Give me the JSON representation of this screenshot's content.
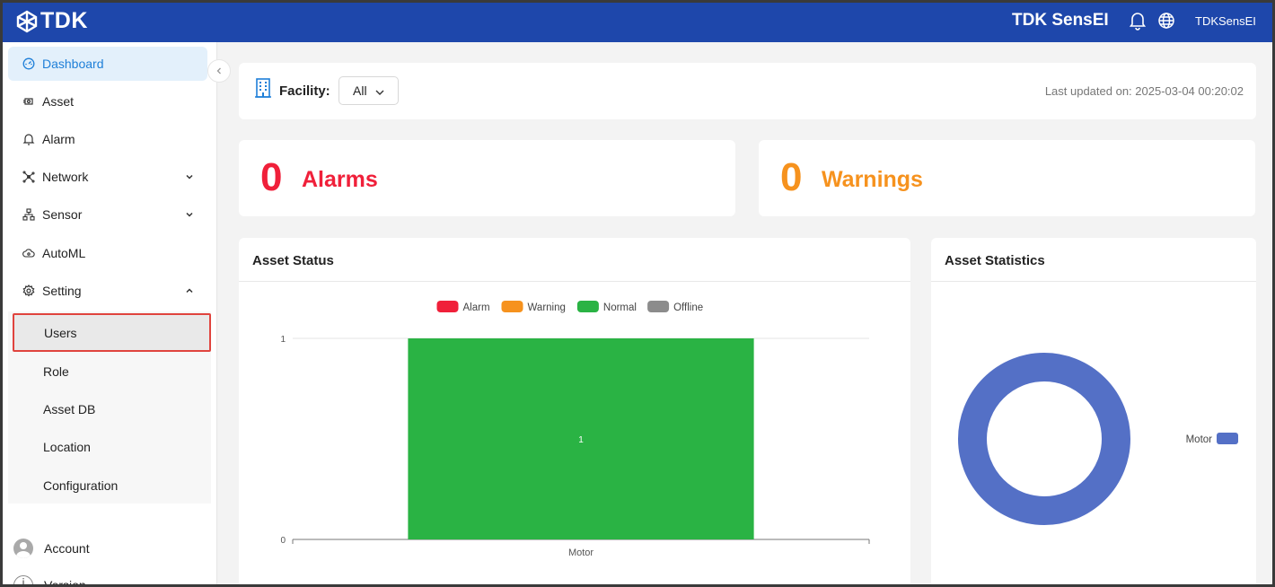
{
  "header": {
    "logo_text": "TDK",
    "product_name": "TDK SensEI",
    "username": "TDKSensEI",
    "brand_color": "#1e47ab"
  },
  "sidebar": {
    "items": [
      {
        "label": "Dashboard",
        "icon": "dashboard-icon",
        "active": true
      },
      {
        "label": "Asset",
        "icon": "asset-icon"
      },
      {
        "label": "Alarm",
        "icon": "bell-icon"
      },
      {
        "label": "Network",
        "icon": "network-icon",
        "expandable": true
      },
      {
        "label": "Sensor",
        "icon": "sensor-icon",
        "expandable": true
      },
      {
        "label": "AutoML",
        "icon": "automl-icon"
      },
      {
        "label": "Setting",
        "icon": "gear-icon",
        "expanded": true
      }
    ],
    "setting_subitems": [
      {
        "label": "Users",
        "selected": true
      },
      {
        "label": "Role"
      },
      {
        "label": "Asset DB"
      },
      {
        "label": "Location"
      },
      {
        "label": "Configuration"
      }
    ],
    "account_label": "Account",
    "version_label": "Version"
  },
  "filter": {
    "facility_label": "Facility:",
    "facility_value": "All",
    "last_updated": "Last updated on: 2025-03-04 00:20:02"
  },
  "summary": {
    "alarms_count": "0",
    "alarms_label": "Alarms",
    "warnings_count": "0",
    "warnings_label": "Warnings",
    "alarm_color": "#f0203a",
    "warning_color": "#f6921e"
  },
  "asset_status": {
    "title": "Asset Status"
  },
  "asset_statistics": {
    "title": "Asset Statistics"
  },
  "chart_data": [
    {
      "type": "bar",
      "categories": [
        "Motor"
      ],
      "series": [
        {
          "name": "Alarm",
          "values": [
            0
          ],
          "color": "#f0203a"
        },
        {
          "name": "Warning",
          "values": [
            0
          ],
          "color": "#f6921e"
        },
        {
          "name": "Normal",
          "values": [
            1
          ],
          "color": "#2ab344"
        },
        {
          "name": "Offline",
          "values": [
            0
          ],
          "color": "#8c8c8c"
        }
      ],
      "data_labels": [
        "1"
      ],
      "y_ticks": [
        "0",
        "1"
      ],
      "ylim": [
        0,
        1
      ],
      "legend": "top-center",
      "stacked": true
    },
    {
      "type": "pie",
      "donut": true,
      "labels": [
        "Motor"
      ],
      "values": [
        1
      ],
      "colors": [
        "#5470c6"
      ],
      "legend": "right"
    }
  ]
}
